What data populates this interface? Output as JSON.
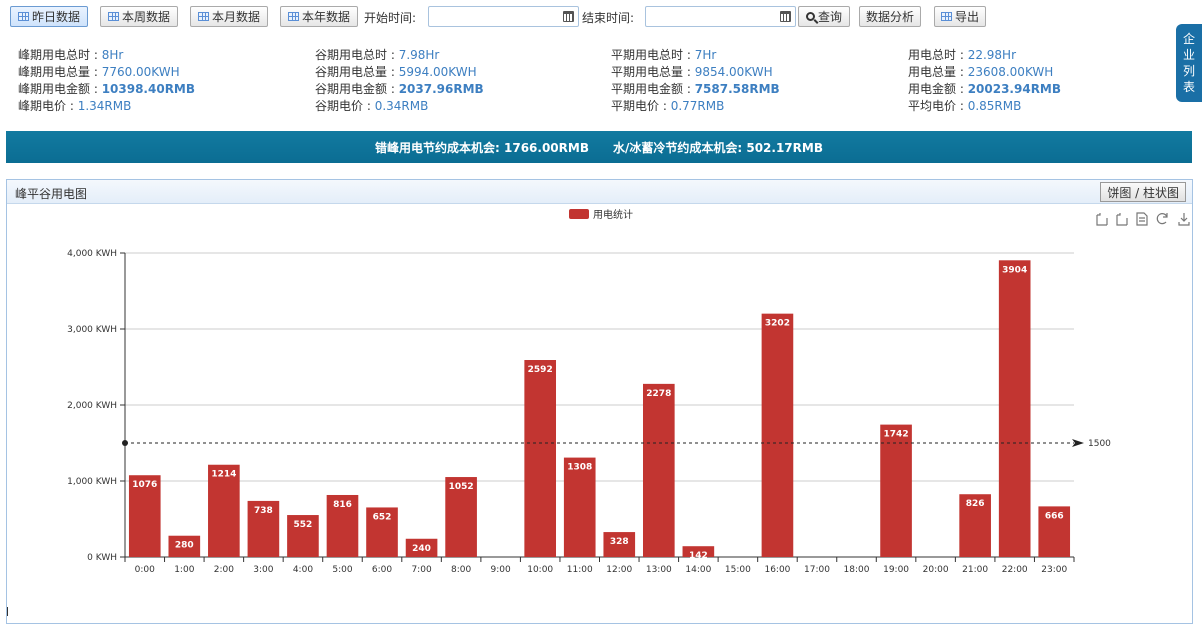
{
  "toolbar": {
    "btn_yesterday": "昨日数据",
    "btn_week": "本周数据",
    "btn_month": "本月数据",
    "btn_year": "本年数据",
    "start_label": "开始时间:",
    "start_value": "",
    "end_label": "结束时间:",
    "end_value": "",
    "btn_query": "查询",
    "btn_analysis": "数据分析",
    "btn_export": "导出"
  },
  "side_tab": {
    "chars": [
      "企",
      "业",
      "列",
      "表"
    ]
  },
  "stats": {
    "peak": {
      "hours_label": "峰期用电总时 : ",
      "hours": "8Hr",
      "amount_label": "峰期用电总量 : ",
      "amount": "7760.00KWH",
      "cost_label": "峰期用电金额 : ",
      "cost": "10398.40RMB",
      "price_label": "峰期电价 : ",
      "price": "1.34RMB"
    },
    "valley": {
      "hours_label": "谷期用电总时 : ",
      "hours": "7.98Hr",
      "amount_label": "谷期用电总量 : ",
      "amount": "5994.00KWH",
      "cost_label": "谷期用电金额 : ",
      "cost": "2037.96RMB",
      "price_label": "谷期电价 : ",
      "price": "0.34RMB"
    },
    "flat": {
      "hours_label": "平期用电总时 : ",
      "hours": "7Hr",
      "amount_label": "平期用电总量 : ",
      "amount": "9854.00KWH",
      "cost_label": "平期用电金额 : ",
      "cost": "7587.58RMB",
      "price_label": "平期电价 : ",
      "price": "0.77RMB"
    },
    "total": {
      "hours_label": "用电总时 : ",
      "hours": "22.98Hr",
      "amount_label": "用电总量 : ",
      "amount": "23608.00KWH",
      "cost_label": "用电金额 : ",
      "cost": "20023.94RMB",
      "price_label": "平均电价 : ",
      "price": "0.85RMB"
    }
  },
  "banner": {
    "text1": "错峰用电节约成本机会: 1766.00RMB",
    "text2": "水/冰蓄冷节约成本机会: 502.17RMB"
  },
  "panel": {
    "title": "峰平谷用电图",
    "toggle_label": "饼图 / 柱状图"
  },
  "colors": {
    "bar": "#c23531",
    "banner": "#0f729a",
    "accent": "#3d7fc1"
  },
  "chart_data": {
    "type": "bar",
    "legend": "用电统计",
    "legend_position": "top-center",
    "categories": [
      "0:00",
      "1:00",
      "2:00",
      "3:00",
      "4:00",
      "5:00",
      "6:00",
      "7:00",
      "8:00",
      "9:00",
      "10:00",
      "11:00",
      "12:00",
      "13:00",
      "14:00",
      "15:00",
      "16:00",
      "17:00",
      "18:00",
      "19:00",
      "20:00",
      "21:00",
      "22:00",
      "23:00"
    ],
    "series": [
      {
        "name": "用电统计",
        "values": [
          1076,
          280,
          1214,
          738,
          552,
          816,
          652,
          240,
          1052,
          0,
          2592,
          1308,
          328,
          2278,
          142,
          0,
          3202,
          0,
          0,
          1742,
          0,
          826,
          3904,
          666
        ]
      }
    ],
    "y_ticks": [
      "0 KWH",
      "1,000 KWH",
      "2,000 KWH",
      "3,000 KWH",
      "4,000 KWH"
    ],
    "ylim": [
      0,
      4000
    ],
    "mark_line": {
      "value": 1500,
      "label": "1500"
    },
    "grid": true,
    "toolbox_icons": [
      "zoom-icon",
      "zoom-reset-icon",
      "data-view-icon",
      "restore-icon",
      "save-image-icon"
    ]
  }
}
